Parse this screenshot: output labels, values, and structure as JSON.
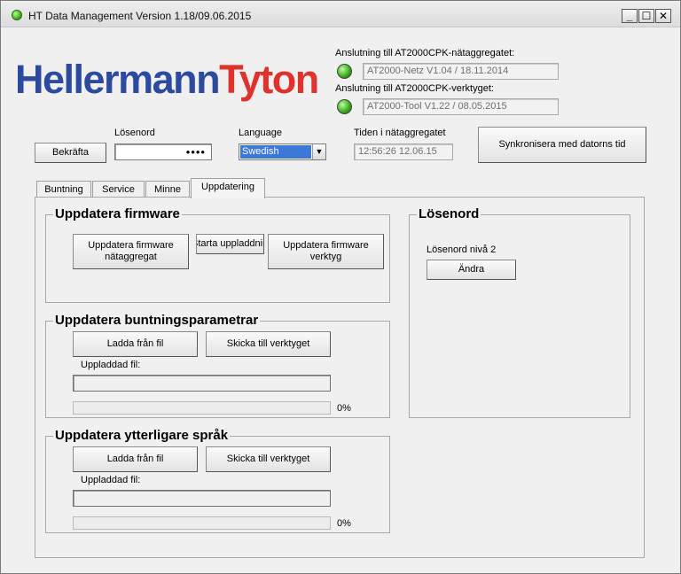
{
  "window": {
    "title": "HT Data Management Version 1.18/09.06.2015",
    "controls": {
      "minimize": "_",
      "maximize": "☐",
      "close": "✕"
    }
  },
  "logo": {
    "part1": "Hellermann",
    "part2": "Tyton"
  },
  "connection": {
    "netz_label": "Anslutning till AT2000CPK-nätaggregatet:",
    "netz_value": "AT2000-Netz V1.04 / 18.11.2014",
    "tool_label": "Anslutning till AT2000CPK-verktyget:",
    "tool_value": "AT2000-Tool V1.22 / 08.05.2015",
    "led_color": "#3aa31c"
  },
  "login": {
    "confirm_button": "Bekräfta",
    "password_label": "Lösenord",
    "password_value": "••••"
  },
  "language": {
    "label": "Language",
    "selected": "Swedish"
  },
  "time": {
    "label": "Tiden i nätaggregatet",
    "value": "12:56:26 12.06.15",
    "sync_button": "Synkronisera med datorns tid"
  },
  "tabs": [
    {
      "label": "Buntning"
    },
    {
      "label": "Service"
    },
    {
      "label": "Minne"
    },
    {
      "label": "Uppdatering"
    }
  ],
  "firmware": {
    "title": "Uppdatera firmware",
    "netz_button": "Uppdatera firmware nätaggregat",
    "start_button": "Starta uppladdning",
    "tool_button": "Uppdatera firmware verktyg"
  },
  "bundling": {
    "title": "Uppdatera buntningsparametrar",
    "load_button": "Ladda från fil",
    "send_button": "Skicka till verktyget",
    "file_label": "Uppladdad fil:",
    "file_value": "",
    "progress_percent": 0,
    "progress_label": "0%"
  },
  "languages": {
    "title": "Uppdatera ytterligare språk",
    "load_button": "Ladda från fil",
    "send_button": "Skicka till verktyget",
    "file_label": "Uppladdad fil:",
    "file_value": "",
    "progress_percent": 0,
    "progress_label": "0%"
  },
  "password_group": {
    "title": "Lösenord",
    "level_label": "Lösenord nivå 2",
    "change_button": "Ändra"
  }
}
